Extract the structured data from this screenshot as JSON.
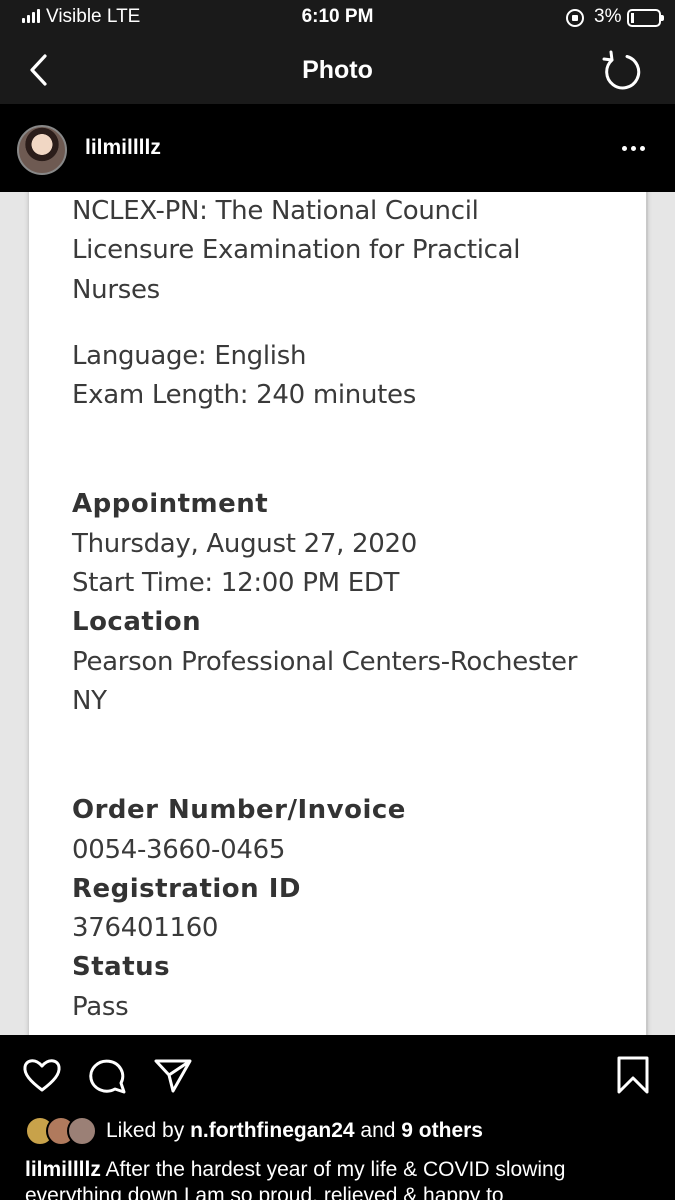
{
  "status_bar": {
    "carrier": "Visible  LTE",
    "time": "6:10 PM",
    "battery": "3%"
  },
  "nav": {
    "title": "Photo",
    "back_icon": "chevron-left-icon",
    "refresh_icon": "refresh-icon"
  },
  "post": {
    "username": "lilmillllz",
    "more_icon": "ellipsis-icon"
  },
  "document": {
    "exam_line1": "NCLEX-PN: The National Council",
    "exam_line2": "Licensure Examination for Practical",
    "exam_line3": "Nurses",
    "language": "Language: English",
    "exam_length": "Exam Length: 240 minutes",
    "appointment_heading": "Appointment",
    "appointment_date": "Thursday, August 27, 2020",
    "start_time": "Start Time: 12:00 PM EDT",
    "location_heading": "Location",
    "location_line1": "Pearson Professional Centers-Rochester",
    "location_line2": "NY",
    "order_heading": "Order Number/Invoice",
    "order_number": "0054-3660-0465",
    "registration_heading": "Registration ID",
    "registration_id": "376401160",
    "status_heading": "Status",
    "status_value": "Pass"
  },
  "actions": {
    "like_icon": "heart-icon",
    "comment_icon": "comment-icon",
    "share_icon": "send-icon",
    "save_icon": "bookmark-icon"
  },
  "likes": {
    "prefix": "Liked by ",
    "user": "n.forthfinegan24",
    "middle": " and ",
    "others": "9 others"
  },
  "caption": {
    "username": "lilmillllz",
    "text": " After the hardest year of my life & COVID slowing everything down I am so proud, relieved & happy to"
  }
}
